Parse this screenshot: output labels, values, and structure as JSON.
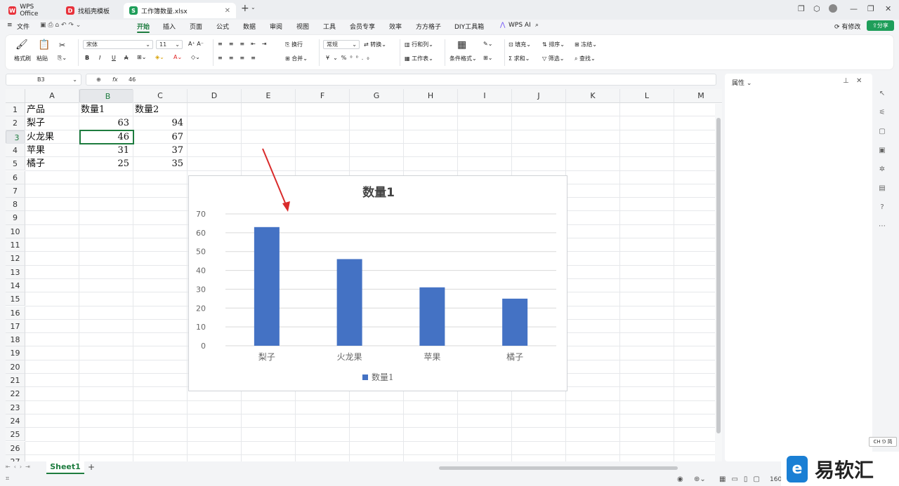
{
  "tabs": [
    {
      "label": "WPS Office",
      "icon": "wps-logo-icon"
    },
    {
      "label": "找稻壳模板",
      "icon": "docer-icon"
    },
    {
      "label": "工作簿数量.xlsx",
      "icon": "spreadsheet-icon"
    }
  ],
  "menu": [
    "文件",
    "开始",
    "插入",
    "页面",
    "公式",
    "数据",
    "审阅",
    "视图",
    "工具",
    "会员专享",
    "效率",
    "方方格子",
    "DIY工具箱",
    "WPS AI"
  ],
  "menu_active": "开始",
  "status_right": {
    "edit": "有修改",
    "share": "分享"
  },
  "ribbon": {
    "format_painter": "格式刷",
    "paste": "粘贴",
    "font_name": "宋体",
    "font_size": "11",
    "wrap": "换行",
    "merge": "合并",
    "number_format": "常规",
    "convert": "转换",
    "rows_cols": "行和列",
    "worksheet": "工作表",
    "cond_format": "条件格式",
    "fill": "填充",
    "sort": "排序",
    "freeze": "冻结",
    "sum": "求和",
    "filter": "筛选",
    "find": "查找"
  },
  "namebox": "B3",
  "formula": "46",
  "columns": [
    "A",
    "B",
    "C",
    "D",
    "E",
    "F",
    "G",
    "H",
    "I",
    "J",
    "K",
    "L",
    "M"
  ],
  "rows": [
    "1",
    "2",
    "3",
    "4",
    "5",
    "6",
    "7",
    "8",
    "9",
    "10",
    "11",
    "12",
    "13",
    "14",
    "15",
    "16",
    "17",
    "18",
    "19",
    "20",
    "21",
    "22",
    "23",
    "24",
    "25",
    "26",
    "27"
  ],
  "cells": {
    "A1": "产品",
    "B1": "数量1",
    "C1": "数量2",
    "A2": "梨子",
    "B2": "63",
    "C2": "94",
    "A3": "火龙果",
    "B3": "46",
    "C3": "67",
    "A4": "苹果",
    "B4": "31",
    "C4": "37",
    "A5": "橘子",
    "B5": "25",
    "C5": "35"
  },
  "chart_data": {
    "type": "bar",
    "title": "数量1",
    "categories": [
      "梨子",
      "火龙果",
      "苹果",
      "橘子"
    ],
    "series": [
      {
        "name": "数量1",
        "values": [
          63,
          46,
          31,
          25
        ],
        "color": "#4472c4"
      }
    ],
    "ylim": [
      0,
      70
    ],
    "yticks": [
      "0",
      "10",
      "20",
      "30",
      "40",
      "50",
      "60",
      "70"
    ],
    "grid": true,
    "legend": "bottom"
  },
  "sheet_tab": "Sheet1",
  "right_pane": {
    "title": "属性"
  },
  "ime": "CH ⅁ 简",
  "zoom": "160",
  "watermark": "易软汇"
}
